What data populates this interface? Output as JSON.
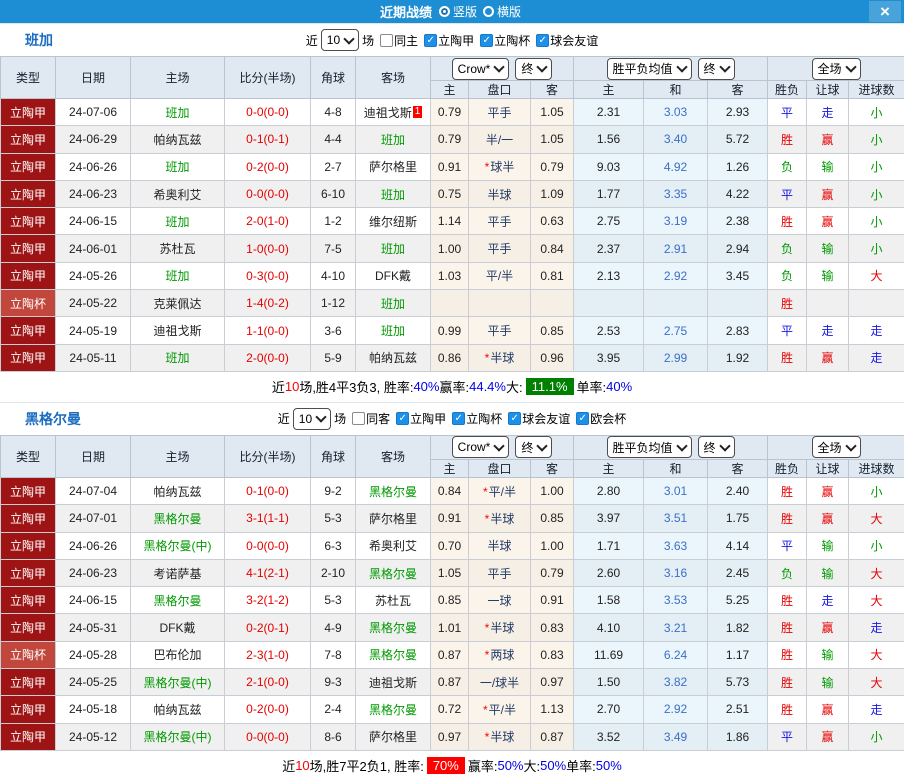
{
  "topbar": {
    "title": "近期战绩",
    "radio_vertical": "竖版",
    "radio_horizontal": "横版"
  },
  "icons": {
    "close": "×",
    "check": "✓"
  },
  "header_cols": [
    "类型",
    "日期",
    "主场",
    "比分(半场)",
    "角球",
    "客场"
  ],
  "sub_cols": [
    "主",
    "盘口",
    "客",
    "主",
    "和",
    "客",
    "胜负",
    "让球",
    "进球数"
  ],
  "dropdowns": {
    "crow": "Crow*",
    "final1": "终",
    "wdl_avg": "胜平负均值",
    "final2": "终",
    "full": "全场"
  },
  "sections": [
    {
      "team": "班加",
      "near_label": "近",
      "games_value": "10",
      "games_label": "场",
      "checkboxes": [
        {
          "label": "同主",
          "checked": false
        },
        {
          "label": "立陶甲",
          "checked": true
        },
        {
          "label": "立陶杯",
          "checked": true
        },
        {
          "label": "球会友谊",
          "checked": true
        }
      ],
      "rows": [
        {
          "league": "立陶甲",
          "date": "24-07-06",
          "home": "班加",
          "home_focus": true,
          "ft": "0-0",
          "ht": "0-0",
          "corner": "4-8",
          "away": "迪祖戈斯",
          "away_focus": false,
          "away_badge": "1",
          "o1": "0.79",
          "line": "平手",
          "star": false,
          "o2": "1.05",
          "e1": "2.31",
          "ex": "3.03",
          "e2": "2.93",
          "r1": "平",
          "r2": "走",
          "r3": "小"
        },
        {
          "league": "立陶甲",
          "date": "24-06-29",
          "home": "帕纳瓦兹",
          "home_focus": false,
          "ft": "0-1",
          "ht": "0-1",
          "corner": "4-4",
          "away": "班加",
          "away_focus": true,
          "away_badge": "",
          "o1": "0.79",
          "line": "半/一",
          "star": false,
          "o2": "1.05",
          "e1": "1.56",
          "ex": "3.40",
          "e2": "5.72",
          "r1": "胜",
          "r2": "赢",
          "r3": "小"
        },
        {
          "league": "立陶甲",
          "date": "24-06-26",
          "home": "班加",
          "home_focus": true,
          "ft": "0-2",
          "ht": "0-0",
          "corner": "2-7",
          "away": "萨尔格里",
          "away_focus": false,
          "away_badge": "",
          "o1": "0.91",
          "line": "球半",
          "star": true,
          "o2": "0.79",
          "e1": "9.03",
          "ex": "4.92",
          "e2": "1.26",
          "r1": "负",
          "r2": "输",
          "r3": "小"
        },
        {
          "league": "立陶甲",
          "date": "24-06-23",
          "home": "希奥利艾",
          "home_focus": false,
          "ft": "0-0",
          "ht": "0-0",
          "corner": "6-10",
          "away": "班加",
          "away_focus": true,
          "away_badge": "",
          "o1": "0.75",
          "line": "半球",
          "star": false,
          "o2": "1.09",
          "e1": "1.77",
          "ex": "3.35",
          "e2": "4.22",
          "r1": "平",
          "r2": "赢",
          "r3": "小"
        },
        {
          "league": "立陶甲",
          "date": "24-06-15",
          "home": "班加",
          "home_focus": true,
          "ft": "2-0",
          "ht": "1-0",
          "corner": "1-2",
          "away": "维尔纽斯",
          "away_focus": false,
          "away_badge": "",
          "o1": "1.14",
          "line": "平手",
          "star": false,
          "o2": "0.63",
          "e1": "2.75",
          "ex": "3.19",
          "e2": "2.38",
          "r1": "胜",
          "r2": "赢",
          "r3": "小"
        },
        {
          "league": "立陶甲",
          "date": "24-06-01",
          "home": "苏杜瓦",
          "home_focus": false,
          "ft": "1-0",
          "ht": "0-0",
          "corner": "7-5",
          "away": "班加",
          "away_focus": true,
          "away_badge": "",
          "o1": "1.00",
          "line": "平手",
          "star": false,
          "o2": "0.84",
          "e1": "2.37",
          "ex": "2.91",
          "e2": "2.94",
          "r1": "负",
          "r2": "输",
          "r3": "小"
        },
        {
          "league": "立陶甲",
          "date": "24-05-26",
          "home": "班加",
          "home_focus": true,
          "ft": "0-3",
          "ht": "0-0",
          "corner": "4-10",
          "away": "DFK戴",
          "away_focus": false,
          "away_badge": "",
          "o1": "1.03",
          "line": "平/半",
          "star": false,
          "o2": "0.81",
          "e1": "2.13",
          "ex": "2.92",
          "e2": "3.45",
          "r1": "负",
          "r2": "输",
          "r3": "大"
        },
        {
          "league": "立陶杯",
          "date": "24-05-22",
          "home": "克莱佩达",
          "home_focus": false,
          "ft": "1-4",
          "ht": "0-2",
          "corner": "1-12",
          "away": "班加",
          "away_focus": true,
          "away_badge": "",
          "o1": "",
          "line": "",
          "star": false,
          "o2": "",
          "e1": "",
          "ex": "",
          "e2": "",
          "r1": "胜",
          "r2": "",
          "r3": ""
        },
        {
          "league": "立陶甲",
          "date": "24-05-19",
          "home": "迪祖戈斯",
          "home_focus": false,
          "ft": "1-1",
          "ht": "0-0",
          "corner": "3-6",
          "away": "班加",
          "away_focus": true,
          "away_badge": "",
          "o1": "0.99",
          "line": "平手",
          "star": false,
          "o2": "0.85",
          "e1": "2.53",
          "ex": "2.75",
          "e2": "2.83",
          "r1": "平",
          "r2": "走",
          "r3": "走"
        },
        {
          "league": "立陶甲",
          "date": "24-05-11",
          "home": "班加",
          "home_focus": true,
          "ft": "2-0",
          "ht": "0-0",
          "corner": "5-9",
          "away": "帕纳瓦兹",
          "away_focus": false,
          "away_badge": "",
          "o1": "0.86",
          "line": "半球",
          "star": true,
          "o2": "0.96",
          "e1": "3.95",
          "ex": "2.99",
          "e2": "1.92",
          "r1": "胜",
          "r2": "赢",
          "r3": "走"
        }
      ],
      "summary": [
        {
          "t": "近"
        },
        {
          "t": "10",
          "c": "seg-red"
        },
        {
          "t": "场,胜4平3负3, 胜率:"
        },
        {
          "t": "40%",
          "c": "seg-blue"
        },
        {
          "t": " 赢率:"
        },
        {
          "t": "44.4%",
          "c": "seg-blue"
        },
        {
          "t": " 大:"
        },
        {
          "t": "11.1%",
          "c": "seg-badge-green"
        },
        {
          "t": " 单率:"
        },
        {
          "t": "40%",
          "c": "seg-blue"
        }
      ]
    },
    {
      "team": "黑格尔曼",
      "near_label": "近",
      "games_value": "10",
      "games_label": "场",
      "checkboxes": [
        {
          "label": "同客",
          "checked": false
        },
        {
          "label": "立陶甲",
          "checked": true
        },
        {
          "label": "立陶杯",
          "checked": true
        },
        {
          "label": "球会友谊",
          "checked": true
        },
        {
          "label": "欧会杯",
          "checked": true
        }
      ],
      "rows": [
        {
          "league": "立陶甲",
          "date": "24-07-04",
          "home": "帕纳瓦兹",
          "home_focus": false,
          "ft": "0-1",
          "ht": "0-0",
          "corner": "9-2",
          "away": "黑格尔曼",
          "away_focus": true,
          "away_badge": "",
          "o1": "0.84",
          "line": "平/半",
          "star": true,
          "o2": "1.00",
          "e1": "2.80",
          "ex": "3.01",
          "e2": "2.40",
          "r1": "胜",
          "r2": "赢",
          "r3": "小"
        },
        {
          "league": "立陶甲",
          "date": "24-07-01",
          "home": "黑格尔曼",
          "home_focus": true,
          "ft": "3-1",
          "ht": "1-1",
          "corner": "5-3",
          "away": "萨尔格里",
          "away_focus": false,
          "away_badge": "",
          "o1": "0.91",
          "line": "半球",
          "star": true,
          "o2": "0.85",
          "e1": "3.97",
          "ex": "3.51",
          "e2": "1.75",
          "r1": "胜",
          "r2": "赢",
          "r3": "大"
        },
        {
          "league": "立陶甲",
          "date": "24-06-26",
          "home": "黑格尔曼(中)",
          "home_focus": true,
          "ft": "0-0",
          "ht": "0-0",
          "corner": "6-3",
          "away": "希奥利艾",
          "away_focus": false,
          "away_badge": "",
          "o1": "0.70",
          "line": "半球",
          "star": false,
          "o2": "1.00",
          "e1": "1.71",
          "ex": "3.63",
          "e2": "4.14",
          "r1": "平",
          "r2": "输",
          "r3": "小"
        },
        {
          "league": "立陶甲",
          "date": "24-06-23",
          "home": "考诺萨基",
          "home_focus": false,
          "ft": "4-1",
          "ht": "2-1",
          "corner": "2-10",
          "away": "黑格尔曼",
          "away_focus": true,
          "away_badge": "",
          "o1": "1.05",
          "line": "平手",
          "star": false,
          "o2": "0.79",
          "e1": "2.60",
          "ex": "3.16",
          "e2": "2.45",
          "r1": "负",
          "r2": "输",
          "r3": "大"
        },
        {
          "league": "立陶甲",
          "date": "24-06-15",
          "home": "黑格尔曼",
          "home_focus": true,
          "ft": "3-2",
          "ht": "1-2",
          "corner": "5-3",
          "away": "苏杜瓦",
          "away_focus": false,
          "away_badge": "",
          "o1": "0.85",
          "line": "一球",
          "star": false,
          "o2": "0.91",
          "e1": "1.58",
          "ex": "3.53",
          "e2": "5.25",
          "r1": "胜",
          "r2": "走",
          "r3": "大"
        },
        {
          "league": "立陶甲",
          "date": "24-05-31",
          "home": "DFK戴",
          "home_focus": false,
          "ft": "0-2",
          "ht": "0-1",
          "corner": "4-9",
          "away": "黑格尔曼",
          "away_focus": true,
          "away_badge": "",
          "o1": "1.01",
          "line": "半球",
          "star": true,
          "o2": "0.83",
          "e1": "4.10",
          "ex": "3.21",
          "e2": "1.82",
          "r1": "胜",
          "r2": "赢",
          "r3": "走"
        },
        {
          "league": "立陶杯",
          "date": "24-05-28",
          "home": "巴布伦加",
          "home_focus": false,
          "ft": "2-3",
          "ht": "1-0",
          "corner": "7-8",
          "away": "黑格尔曼",
          "away_focus": true,
          "away_badge": "",
          "o1": "0.87",
          "line": "两球",
          "star": true,
          "o2": "0.83",
          "e1": "11.69",
          "ex": "6.24",
          "e2": "1.17",
          "r1": "胜",
          "r2": "输",
          "r3": "大"
        },
        {
          "league": "立陶甲",
          "date": "24-05-25",
          "home": "黑格尔曼(中)",
          "home_focus": true,
          "ft": "2-1",
          "ht": "0-0",
          "corner": "9-3",
          "away": "迪祖戈斯",
          "away_focus": false,
          "away_badge": "",
          "o1": "0.87",
          "line": "一/球半",
          "star": false,
          "o2": "0.97",
          "e1": "1.50",
          "ex": "3.82",
          "e2": "5.73",
          "r1": "胜",
          "r2": "输",
          "r3": "大"
        },
        {
          "league": "立陶甲",
          "date": "24-05-18",
          "home": "帕纳瓦兹",
          "home_focus": false,
          "ft": "0-2",
          "ht": "0-0",
          "corner": "2-4",
          "away": "黑格尔曼",
          "away_focus": true,
          "away_badge": "",
          "o1": "0.72",
          "line": "平/半",
          "star": true,
          "o2": "1.13",
          "e1": "2.70",
          "ex": "2.92",
          "e2": "2.51",
          "r1": "胜",
          "r2": "赢",
          "r3": "走"
        },
        {
          "league": "立陶甲",
          "date": "24-05-12",
          "home": "黑格尔曼(中)",
          "home_focus": true,
          "ft": "0-0",
          "ht": "0-0",
          "corner": "8-6",
          "away": "萨尔格里",
          "away_focus": false,
          "away_badge": "",
          "o1": "0.97",
          "line": "半球",
          "star": true,
          "o2": "0.87",
          "e1": "3.52",
          "ex": "3.49",
          "e2": "1.86",
          "r1": "平",
          "r2": "赢",
          "r3": "小"
        }
      ],
      "summary": [
        {
          "t": "近"
        },
        {
          "t": "10",
          "c": "seg-red"
        },
        {
          "t": "场,胜7平2负1, 胜率:"
        },
        {
          "t": "70%",
          "c": "seg-badge-red"
        },
        {
          "t": " 赢率:"
        },
        {
          "t": "50%",
          "c": "seg-blue"
        },
        {
          "t": " 大:"
        },
        {
          "t": "50%",
          "c": "seg-blue"
        },
        {
          "t": " 单率:"
        },
        {
          "t": "50%",
          "c": "seg-blue"
        }
      ]
    }
  ]
}
